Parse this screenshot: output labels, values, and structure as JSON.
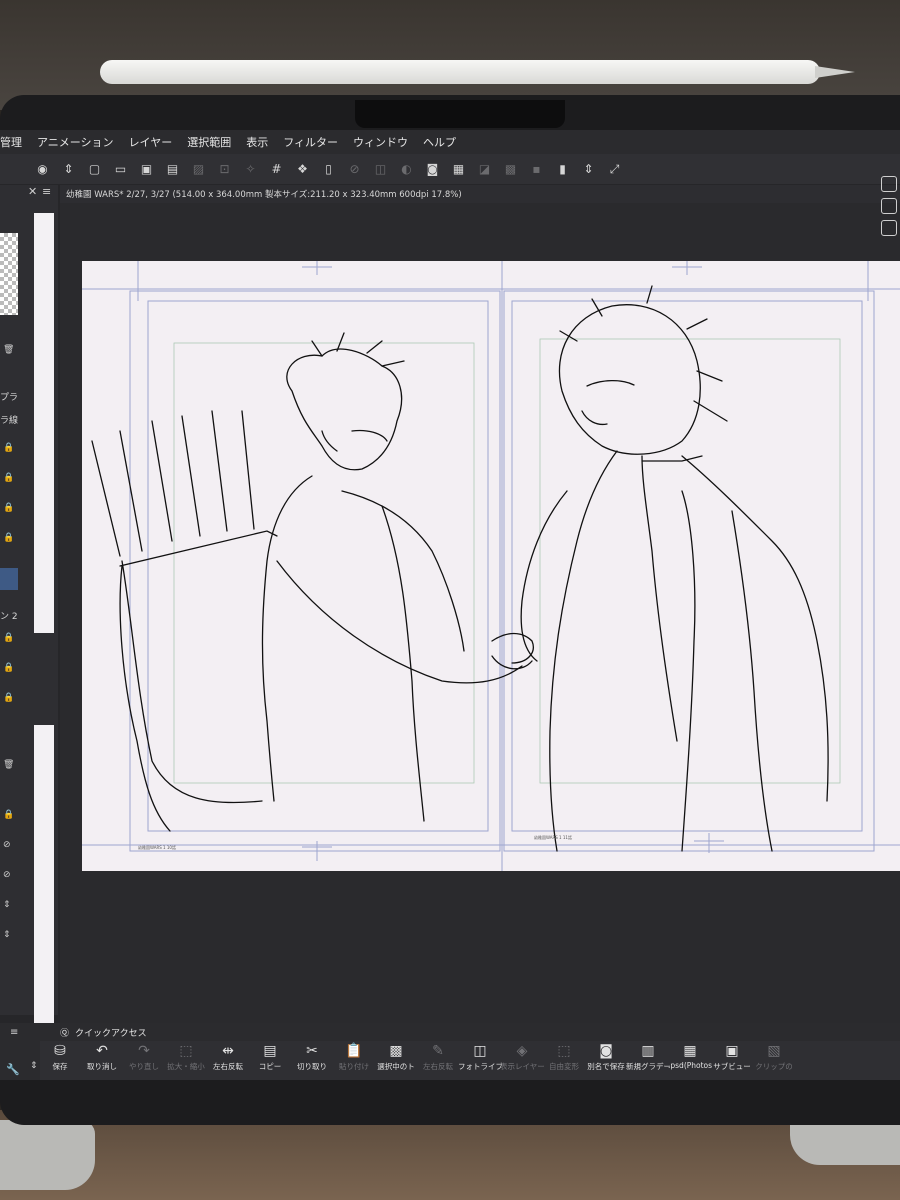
{
  "menu": [
    "管理",
    "アニメーション",
    "レイヤー",
    "選択範囲",
    "表示",
    "フィルター",
    "ウィンドウ",
    "ヘルプ"
  ],
  "document_tab": "幼稚園 WARS* 2/27, 3/27 (514.00 x 364.00mm 製本サイズ:211.20 x 323.40mm 600dpi 17.8%)",
  "left_panel": {
    "labels": [
      "プラ",
      "ラ線",
      "ン 2"
    ]
  },
  "canvas_captions": {
    "left": "幼稚園WARS 1 10話",
    "right": "幼稚園WARS 1 11話"
  },
  "quick_access": {
    "title": "クイックアクセス",
    "items": [
      {
        "label": "保存",
        "icon": "save-icon",
        "enabled": true
      },
      {
        "label": "取り消し",
        "icon": "undo-icon",
        "enabled": true
      },
      {
        "label": "やり直し",
        "icon": "redo-icon",
        "enabled": false
      },
      {
        "label": "拡大・縮小",
        "icon": "scale-icon",
        "enabled": false
      },
      {
        "label": "左右反転",
        "icon": "flip-icon",
        "enabled": true
      },
      {
        "label": "コピー",
        "icon": "copy-icon",
        "enabled": true
      },
      {
        "label": "切り取り",
        "icon": "cut-icon",
        "enabled": true
      },
      {
        "label": "貼り付け",
        "icon": "paste-icon",
        "enabled": false
      },
      {
        "label": "選択中のト",
        "icon": "checker-icon",
        "enabled": true
      },
      {
        "label": "左右反転",
        "icon": "pen-icon",
        "enabled": false
      },
      {
        "label": "フォトライブ",
        "icon": "photo-icon",
        "enabled": true
      },
      {
        "label": "表示レイヤー",
        "icon": "layers-icon",
        "enabled": false
      },
      {
        "label": "自由変形",
        "icon": "transform-icon",
        "enabled": false
      },
      {
        "label": "別名で保存",
        "icon": "save-as-icon",
        "enabled": true
      },
      {
        "label": "新規グラデー",
        "icon": "gradient-icon",
        "enabled": true
      },
      {
        "label": ".psd(Photos",
        "icon": "psd-icon",
        "enabled": true
      },
      {
        "label": "サブビュー",
        "icon": "subview-icon",
        "enabled": true
      },
      {
        "label": "クリップの",
        "icon": "clip-icon",
        "enabled": false
      }
    ]
  },
  "colors": {
    "accent": "#3e5a85",
    "canvas": "#f3eff3",
    "ui_dark": "#2b2b2e"
  }
}
